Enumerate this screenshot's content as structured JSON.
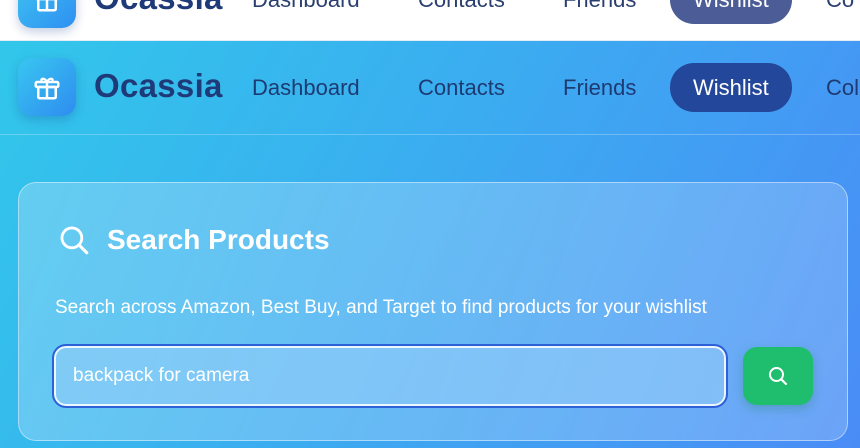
{
  "app": {
    "name": "Ocassia",
    "logo_icon": "gift-icon"
  },
  "nav": {
    "items": [
      {
        "label": "Dashboard",
        "active": false
      },
      {
        "label": "Contacts",
        "active": false
      },
      {
        "label": "Friends",
        "active": false
      },
      {
        "label": "Wishlist",
        "active": true
      },
      {
        "label": "Col",
        "active": false
      }
    ]
  },
  "ghost_nav": {
    "items": [
      {
        "label": "Dashboard"
      },
      {
        "label": "Contacts"
      },
      {
        "label": "Friends"
      },
      {
        "label": "Wishlist"
      },
      {
        "label": "Co"
      }
    ]
  },
  "search": {
    "title": "Search Products",
    "title_icon": "search-icon",
    "description": "Search across Amazon, Best Buy, and Target to find products for your wishlist",
    "input_value": "backpack for camera",
    "button_icon": "search-icon"
  },
  "colors": {
    "accent": "#23479a",
    "brand_text": "#1f3a78",
    "search_button": "#1fbd6e"
  }
}
